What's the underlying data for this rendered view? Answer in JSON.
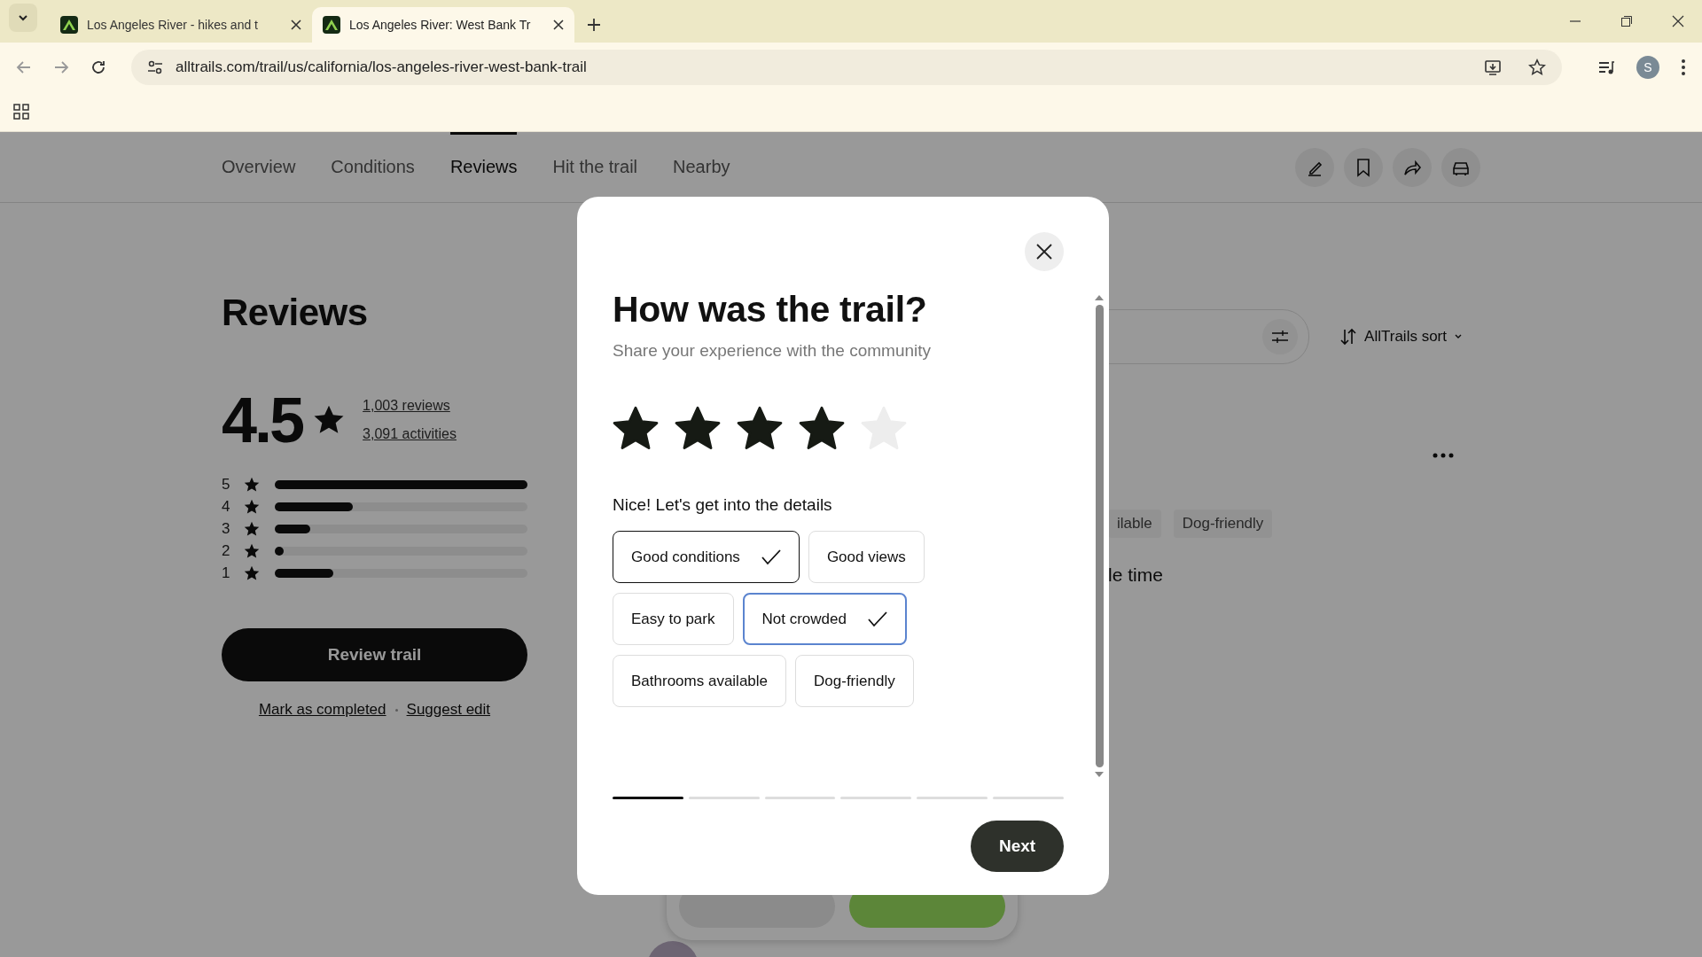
{
  "browser": {
    "tabs": [
      {
        "title": "Los Angeles River - hikes and t",
        "selected": false
      },
      {
        "title": "Los Angeles River: West Bank Tr",
        "selected": true
      }
    ],
    "url": "alltrails.com/trail/us/california/los-angeles-river-west-bank-trail",
    "profile_initial": "S"
  },
  "page_nav": {
    "items": [
      {
        "label": "Overview",
        "selected": false
      },
      {
        "label": "Conditions",
        "selected": false
      },
      {
        "label": "Reviews",
        "selected": true
      },
      {
        "label": "Hit the trail",
        "selected": false
      },
      {
        "label": "Nearby",
        "selected": false
      }
    ]
  },
  "reviews_summary": {
    "heading": "Reviews",
    "rating": "4.5",
    "reviews_link": "1,003 reviews",
    "activities_link": "3,091 activities",
    "breakdown": [
      {
        "stars_label": "5",
        "level": 1.0
      },
      {
        "stars_label": "4",
        "level": 0.31
      },
      {
        "stars_label": "3",
        "level": 0.14
      },
      {
        "stars_label": "2",
        "level": 0.03
      },
      {
        "stars_label": "1",
        "level": 0.23
      }
    ],
    "review_button": "Review trail",
    "links": [
      "Mark as completed",
      "Suggest edit"
    ]
  },
  "review_list": {
    "sort_label": "AllTrails sort",
    "tags": [
      "ilable",
      "Dog-friendly"
    ],
    "snippet": "le time"
  },
  "modal": {
    "title": "How was the trail?",
    "subtitle": "Share your experience with the community",
    "rating": {
      "stars": 4
    },
    "details_prompt": "Nice! Let's get into the details",
    "chips": [
      {
        "label": "Good conditions",
        "selected": true,
        "focused": false
      },
      {
        "label": "Good views",
        "selected": false,
        "focused": false
      },
      {
        "label": "Easy to park",
        "selected": false,
        "focused": false
      },
      {
        "label": "Not crowded",
        "selected": true,
        "focused": true
      },
      {
        "label": "Bathrooms available",
        "selected": false,
        "focused": false
      },
      {
        "label": "Dog-friendly",
        "selected": false,
        "focused": false
      }
    ],
    "progress": [
      {
        "selected": true
      },
      {
        "selected": false
      },
      {
        "selected": false
      },
      {
        "selected": false
      },
      {
        "selected": false
      },
      {
        "selected": false
      }
    ],
    "next_button": "Next"
  }
}
